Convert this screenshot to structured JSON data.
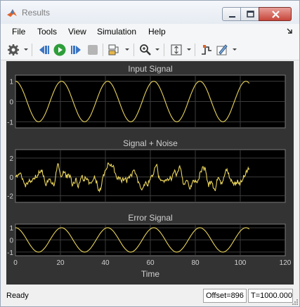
{
  "window": {
    "title": "Results"
  },
  "menu": [
    "File",
    "Tools",
    "View",
    "Simulation",
    "Help"
  ],
  "toolbar_icons": [
    "settings-gear-icon",
    "step-back-icon",
    "run-icon",
    "step-forward-icon",
    "stop-icon",
    "signal-selector-icon",
    "zoom-icon",
    "autoscale-icon",
    "triggers-icon",
    "style-icon"
  ],
  "colors": {
    "plot_bg": "#333333",
    "axes_bg": "#000000",
    "trace": "#e8d35a",
    "grid": "#3c3c3c",
    "text": "#d0d0d0"
  },
  "chart_data": [
    {
      "type": "line",
      "title": "Input Signal",
      "xlim": [
        0,
        120
      ],
      "ylim": [
        -1.3,
        1.3
      ],
      "yticks": [
        1,
        0,
        -1
      ],
      "xtick_labels_shown": false,
      "series": [
        {
          "function": "sine",
          "amplitude": 1,
          "period": 20.5,
          "phase": 0.25,
          "x_end": 104
        }
      ]
    },
    {
      "type": "line",
      "title": "Signal + Noise",
      "xlim": [
        0,
        120
      ],
      "ylim": [
        -2.7,
        2.9
      ],
      "yticks": [
        2,
        0,
        -2
      ],
      "xtick_labels_shown": false,
      "series": [
        {
          "function": "sine+noise",
          "amplitude": 1,
          "noise_level": 0.9,
          "x_end": 104
        }
      ]
    },
    {
      "type": "line",
      "title": "Error Signal",
      "xlim": [
        0,
        120
      ],
      "ylim": [
        -1.3,
        1.3
      ],
      "yticks": [
        1,
        0,
        -1
      ],
      "xticks": [
        0,
        20,
        40,
        60,
        80,
        100,
        120
      ],
      "xlabel": "Time",
      "series": [
        {
          "function": "sine",
          "amplitude": 1,
          "period": 20.5,
          "phase": 0.25,
          "x_end": 104
        }
      ]
    }
  ],
  "status": {
    "left": "Ready",
    "offset": "Offset=896",
    "time": "T=1000.000"
  }
}
